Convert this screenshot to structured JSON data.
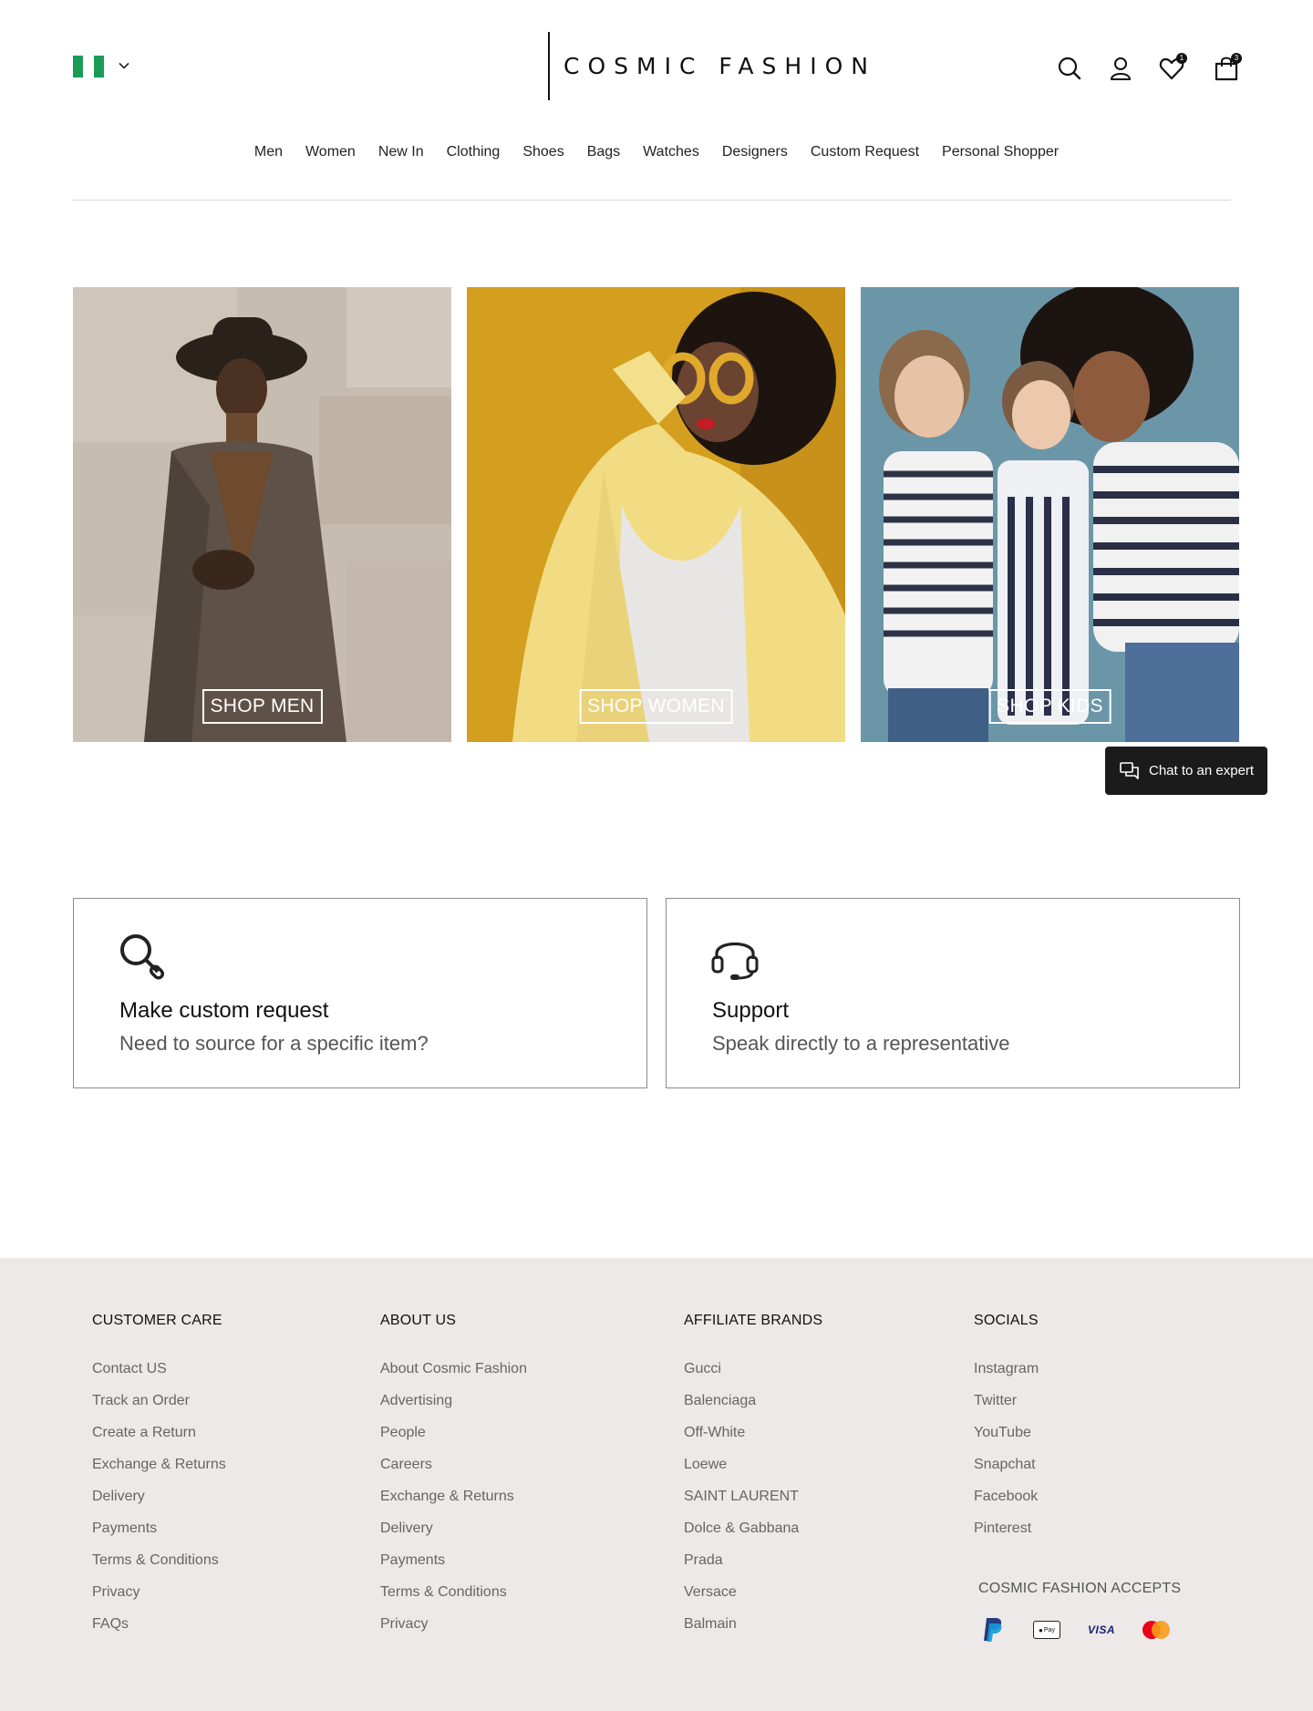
{
  "header": {
    "logo": "COSMIC FASHION",
    "wishlist_count": "1",
    "cart_count": "3"
  },
  "nav": [
    "Men",
    "Women",
    "New In",
    "Clothing",
    "Shoes",
    "Bags",
    "Watches",
    "Designers",
    "Custom Request",
    "Personal Shopper"
  ],
  "hero": {
    "men_label": "SHOP MEN",
    "women_label": "SHOP WOMEN",
    "kids_label": "SHOP KIDS"
  },
  "chat": {
    "label": "Chat to an expert"
  },
  "cards": {
    "custom": {
      "title": "Make custom request",
      "subtitle": "Need to source for a specific item?"
    },
    "support": {
      "title": "Support",
      "subtitle": "Speak directly to a representative"
    }
  },
  "footer": {
    "customer_care": {
      "heading": "CUSTOMER CARE",
      "links": [
        "Contact US",
        "Track an Order",
        "Create a Return",
        "Exchange & Returns",
        "Delivery",
        "Payments",
        "Terms & Conditions",
        "Privacy",
        "FAQs"
      ]
    },
    "about_us": {
      "heading": "ABOUT US",
      "links": [
        "About Cosmic Fashion",
        "Advertising",
        "People",
        "Careers",
        "Exchange & Returns",
        "Delivery",
        "Payments",
        "Terms & Conditions",
        "Privacy"
      ]
    },
    "affiliate_brands": {
      "heading": "AFFILIATE BRANDS",
      "links": [
        "Gucci",
        "Balenciaga",
        "Off-White",
        "Loewe",
        "SAINT LAURENT",
        "Dolce & Gabbana",
        "Prada",
        "Versace",
        "Balmain"
      ]
    },
    "socials": {
      "heading": "SOCIALS",
      "links": [
        "Instagram",
        "Twitter",
        "YouTube",
        "Snapchat",
        "Facebook",
        "Pinterest"
      ]
    },
    "accepts": "COSMIC FASHION ACCEPTS",
    "applepay_text": "Pay",
    "visa_text": "VISA"
  },
  "colors": {
    "flag_green": "#1a9c57",
    "footer_bg": "#ece9e8",
    "chat_bg": "#1b1b1b",
    "women_bg": "#d49f1e",
    "kids_bg": "#5f8ea0"
  }
}
